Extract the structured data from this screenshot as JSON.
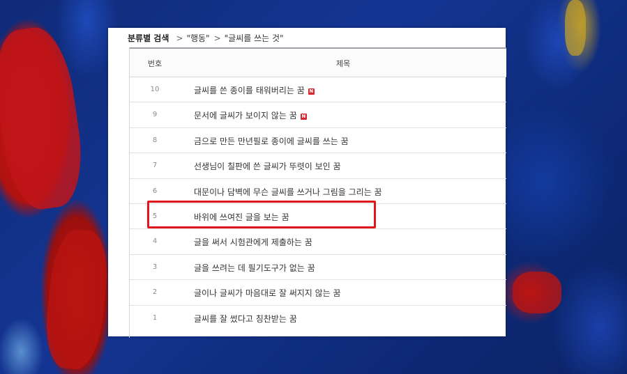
{
  "breadcrumb": {
    "category_label": "분류별 검색",
    "separator": ">",
    "level1": "\"행동\"",
    "level2": "\"글씨를 쓰는 것\""
  },
  "table": {
    "headers": {
      "number": "번호",
      "title": "제목"
    },
    "new_badge_label": "N",
    "rows": [
      {
        "number": "10",
        "title": "글씨를 쓴 종이를 태워버리는 꿈",
        "is_new": true
      },
      {
        "number": "9",
        "title": "문서에 글씨가 보이지 않는 꿈",
        "is_new": true
      },
      {
        "number": "8",
        "title": "금으로 만든 만년필로 종이에 글씨를 쓰는 꿈",
        "is_new": false
      },
      {
        "number": "7",
        "title": "선생님이 칠판에 쓴 글씨가 뚜렷이 보인 꿈",
        "is_new": false
      },
      {
        "number": "6",
        "title": "대문이나 담벽에 무슨 글씨를 쓰거나 그림을 그리는 꿈",
        "is_new": false
      },
      {
        "number": "5",
        "title": "바위에 쓰여진 글을 보는 꿈",
        "is_new": false,
        "highlighted": true
      },
      {
        "number": "4",
        "title": "글을 써서 시험관에게 제출하는 꿈",
        "is_new": false
      },
      {
        "number": "3",
        "title": "글을 쓰려는 데 필기도구가 없는 꿈",
        "is_new": false
      },
      {
        "number": "2",
        "title": "글이나 글씨가 마음대로 잘 써지지 않는 꿈",
        "is_new": false
      },
      {
        "number": "1",
        "title": "글씨를 잘 썼다고 칭찬받는 꿈",
        "is_new": false
      }
    ]
  },
  "colors": {
    "highlight_border": "#e0161c",
    "new_badge": "#d8262e"
  }
}
